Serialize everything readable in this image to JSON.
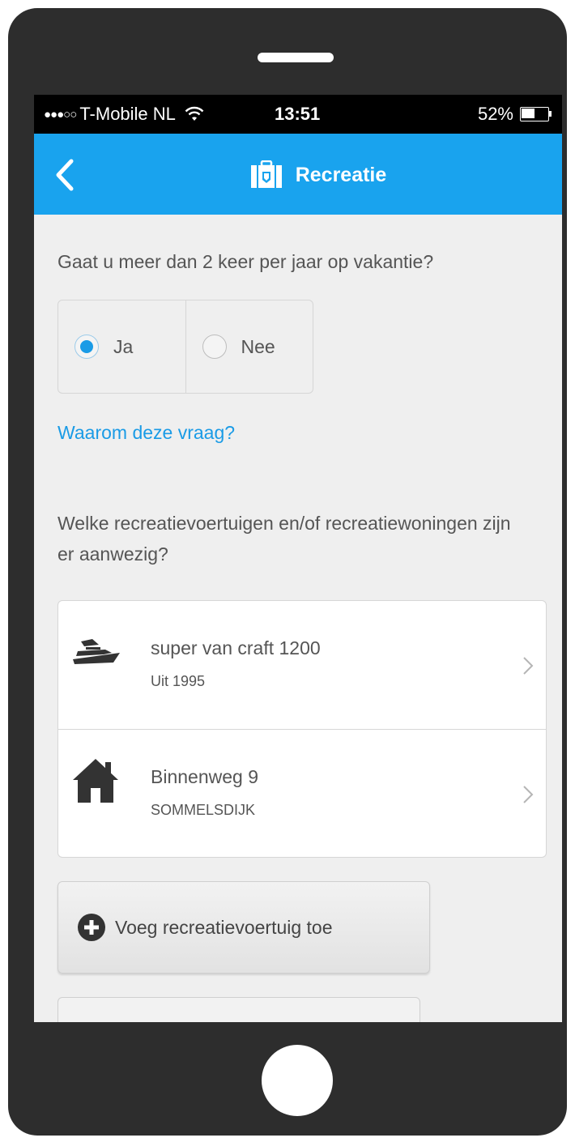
{
  "status_bar": {
    "carrier": "T-Mobile NL",
    "signal_icon": "signal-dots",
    "wifi_icon": "wifi-icon",
    "time": "13:51",
    "battery_percent": "52%",
    "battery_level": 0.52
  },
  "nav": {
    "back_icon": "chevron-left-icon",
    "title_icon": "suitcase-icon",
    "title": "Recreatie"
  },
  "question1": {
    "text": "Gaat u meer dan 2 keer per jaar op vakantie?",
    "options": [
      {
        "label": "Ja",
        "selected": true
      },
      {
        "label": "Nee",
        "selected": false
      }
    ],
    "why_link": "Waarom deze vraag?"
  },
  "question2": {
    "text": "Welke recreatievoertuigen en/of recreatiewoningen zijn er aanwezig?",
    "items": [
      {
        "icon": "boat-icon",
        "title": "super van craft 1200",
        "subtitle": "Uit 1995"
      },
      {
        "icon": "house-icon",
        "title": "Binnenweg 9",
        "subtitle": "SOMMELSDIJK"
      }
    ]
  },
  "add_button": {
    "icon": "plus-circle-icon",
    "label": "Voeg recreatievoertuig toe"
  },
  "colors": {
    "accent": "#19a3ee",
    "link": "#1a9be6",
    "background": "#efefef",
    "phone_body": "#2d2d2d"
  }
}
